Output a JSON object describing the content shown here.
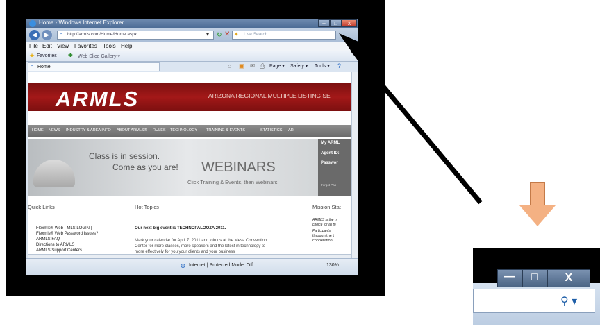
{
  "window": {
    "title": "Home - Windows Internet Explorer",
    "address": "http://armls.com/Home/Home.aspx",
    "search_placeholder": "Live Search"
  },
  "menu": [
    "File",
    "Edit",
    "View",
    "Favorites",
    "Tools",
    "Help"
  ],
  "favorites": {
    "label": "Favorites",
    "web_slice": "Web Slice Gallery ▾"
  },
  "tab": {
    "label": "Home"
  },
  "commandbar": {
    "page": "Page ▾",
    "safety": "Safety ▾",
    "tools": "Tools ▾"
  },
  "site": {
    "logo": "ARMLS",
    "tagline": "ARIZONA REGIONAL MULTIPLE LISTING SE",
    "nav": [
      "HOME",
      "NEWS",
      "INDUSTRY & AREA INFO",
      "ABOUT ARMLS®",
      "RULES",
      "TECHNOLOGY",
      "TRAINING & EVENTS",
      "STATISTICS",
      "AR"
    ],
    "banner": {
      "line1": "Class is in session.",
      "line2": "Come as you are!",
      "webinars": "WEBINARS",
      "sub": "Click Training & Events, then Webinars"
    },
    "login": {
      "title": "My ARML",
      "agent": "Agent ID:",
      "password": "Passwor",
      "forgot": "Forgot Pas"
    },
    "quick_links": {
      "title": "Quick Links",
      "items": [
        "Flexmls® Web - MLS LOGIN |",
        "Flexmls® Web Password Issues?",
        "ARMLS FAQ",
        "Directions to ARMLS",
        "ARMLS Support Centers"
      ]
    },
    "hot_topics": {
      "title": "Hot Topics",
      "headline": "Our next big event is TECHNOPALOOZA 2011.",
      "body1": "Mark your calendar for April 7, 2011 and join us at the Mesa Convention",
      "body2": "Center for more classes, more speakers and the latest in technology to",
      "body3": "more effectively for you your clients and your business"
    },
    "mission": {
      "title": "Mission Stat",
      "l1": "ARMLS is the n",
      "l2": "choice for all th",
      "l3": "Participants",
      "l4": "through the t",
      "l5": "cooperation"
    }
  },
  "status": {
    "zone": "Internet | Protected Mode: Off",
    "zoom": "130%"
  },
  "zoom_inset": {
    "minimize": "—",
    "maximize": "□",
    "close": "X",
    "search_glyph": "⚲ ▾"
  }
}
